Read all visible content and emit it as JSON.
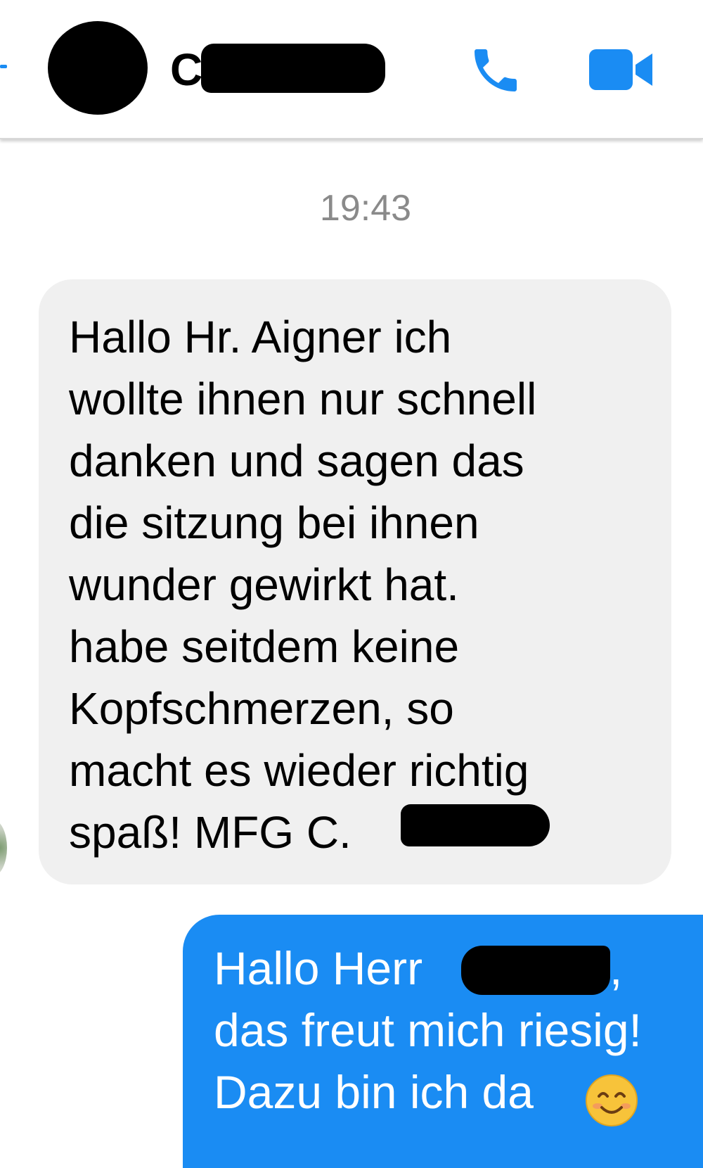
{
  "header": {
    "contact_initial": "C",
    "icons": {
      "phone": "phone-icon",
      "video": "video-camera-icon"
    },
    "accent_color": "#1a8cf3"
  },
  "timestamp": "19:43",
  "messages": [
    {
      "direction": "incoming",
      "text_before_redaction": "Hallo Hr. Aigner ich\nwollte ihnen nur schnell\ndanken und sagen das\ndie sitzung bei ihnen\nwunder gewirkt hat.\nhabe seitdem keine\nKopfschmerzen, so\nmacht es wieder richtig\nspaß!  MFG C."
    },
    {
      "direction": "outgoing",
      "line1_before_redaction": "Hallo Herr ",
      "line1_after_redaction": ",",
      "line2": "das freut mich riesig!",
      "line3": "Dazu bin ich da",
      "emoji": "smiling-face-emoji"
    }
  ]
}
